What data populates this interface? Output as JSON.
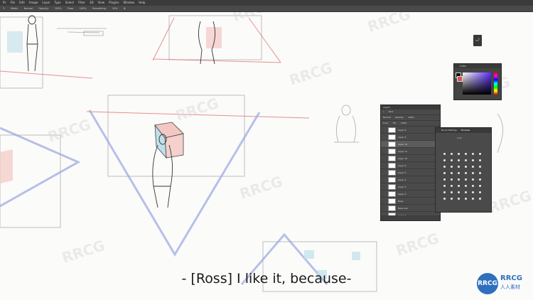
{
  "menu": {
    "items": [
      "Ps",
      "File",
      "Edit",
      "Image",
      "Layer",
      "Type",
      "Select",
      "Filter",
      "3D",
      "View",
      "Plugins",
      "Window",
      "Help"
    ]
  },
  "options_bar": {
    "mode_label": "Mode:",
    "mode_value": "Normal",
    "opacity_label": "Opacity:",
    "opacity_value": "100%",
    "flow_label": "Flow:",
    "flow_value": "100%",
    "smoothing_label": "Smoothing:",
    "smoothing_value": "10%"
  },
  "color_panel": {
    "title": "Color",
    "foreground": "#111111",
    "background": "#d9534f"
  },
  "layers_panel": {
    "title": "Layers",
    "kind_label": "Kind",
    "blend_mode": "Normal",
    "opacity_label": "Opacity:",
    "opacity_value": "100%",
    "lock_label": "Lock:",
    "fill_label": "Fill:",
    "fill_value": "100%",
    "layers": [
      {
        "name": "Layer 8",
        "selected": false
      },
      {
        "name": "Layer 9",
        "selected": false
      },
      {
        "name": "Layer 12",
        "selected": true
      },
      {
        "name": "Layer 11",
        "selected": false
      },
      {
        "name": "Layer 10",
        "selected": false
      },
      {
        "name": "Layer 6",
        "selected": false
      },
      {
        "name": "Layer 5",
        "selected": false
      },
      {
        "name": "Layer 4",
        "selected": false
      },
      {
        "name": "Layer 3",
        "selected": false
      },
      {
        "name": "Layer 2",
        "selected": false
      },
      {
        "name": "Base",
        "selected": false
      },
      {
        "name": "Base sub",
        "selected": false
      },
      {
        "name": "Layer 1",
        "selected": false
      }
    ]
  },
  "brushes_panel": {
    "tabs": [
      "Brush Settings",
      "Brushes"
    ],
    "active_tab": "Brushes",
    "size_value": "1 px"
  },
  "subtitle": "- [Ross] I like it, because-",
  "watermark": {
    "logo_letters": "RRCG",
    "name": "RRCG",
    "sub": "人人素材"
  },
  "colors": {
    "sketch_red": "#e26b6b",
    "sketch_blue": "#9aa6e0",
    "panel_bg": "#4a4a4a",
    "accent_blue": "#2f6fbe"
  }
}
